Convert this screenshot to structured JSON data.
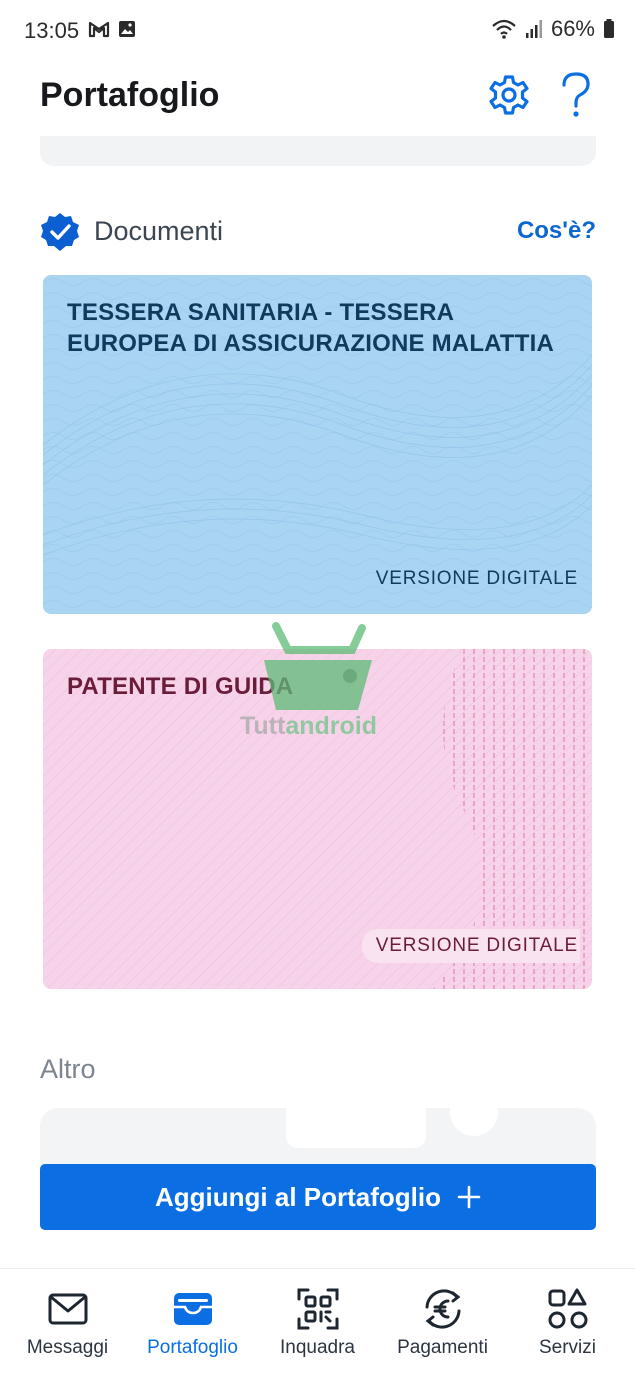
{
  "status_bar": {
    "time": "13:05",
    "battery": "66%",
    "icons": [
      "gmail-icon",
      "gallery-icon",
      "wifi-icon",
      "signal-icon",
      "battery-icon"
    ]
  },
  "header": {
    "title": "Portafoglio",
    "icons": [
      "gear-icon",
      "help-icon"
    ]
  },
  "documents_section": {
    "label": "Documenti",
    "link": "Cos'è?",
    "badge_icon": "verified-check-icon",
    "cards": [
      {
        "title": "TESSERA SANITARIA - TESSERA EUROPEA DI ASSICURAZIONE MALATTIA",
        "badge": "VERSIONE DIGITALE",
        "color": "#a9d4f2"
      },
      {
        "title": "PATENTE DI GUIDA",
        "badge": "VERSIONE DIGITALE",
        "color": "#f7d3ea"
      }
    ]
  },
  "watermark": {
    "part1": "Tutt",
    "part2": "android"
  },
  "other_section": {
    "label": "Altro"
  },
  "add_button": {
    "label": "Aggiungi al Portafoglio",
    "icon": "plus-icon"
  },
  "bottom_nav": {
    "items": [
      {
        "label": "Messaggi",
        "icon": "mail-icon",
        "active": false
      },
      {
        "label": "Portafoglio",
        "icon": "wallet-icon",
        "active": true
      },
      {
        "label": "Inquadra",
        "icon": "qr-scan-icon",
        "active": false
      },
      {
        "label": "Pagamenti",
        "icon": "euro-icon",
        "active": false
      },
      {
        "label": "Servizi",
        "icon": "services-grid-icon",
        "active": false
      }
    ]
  },
  "colors": {
    "accent": "#0b6fe3",
    "health_card": "#a9d4f2",
    "license_card": "#f7d3ea"
  }
}
